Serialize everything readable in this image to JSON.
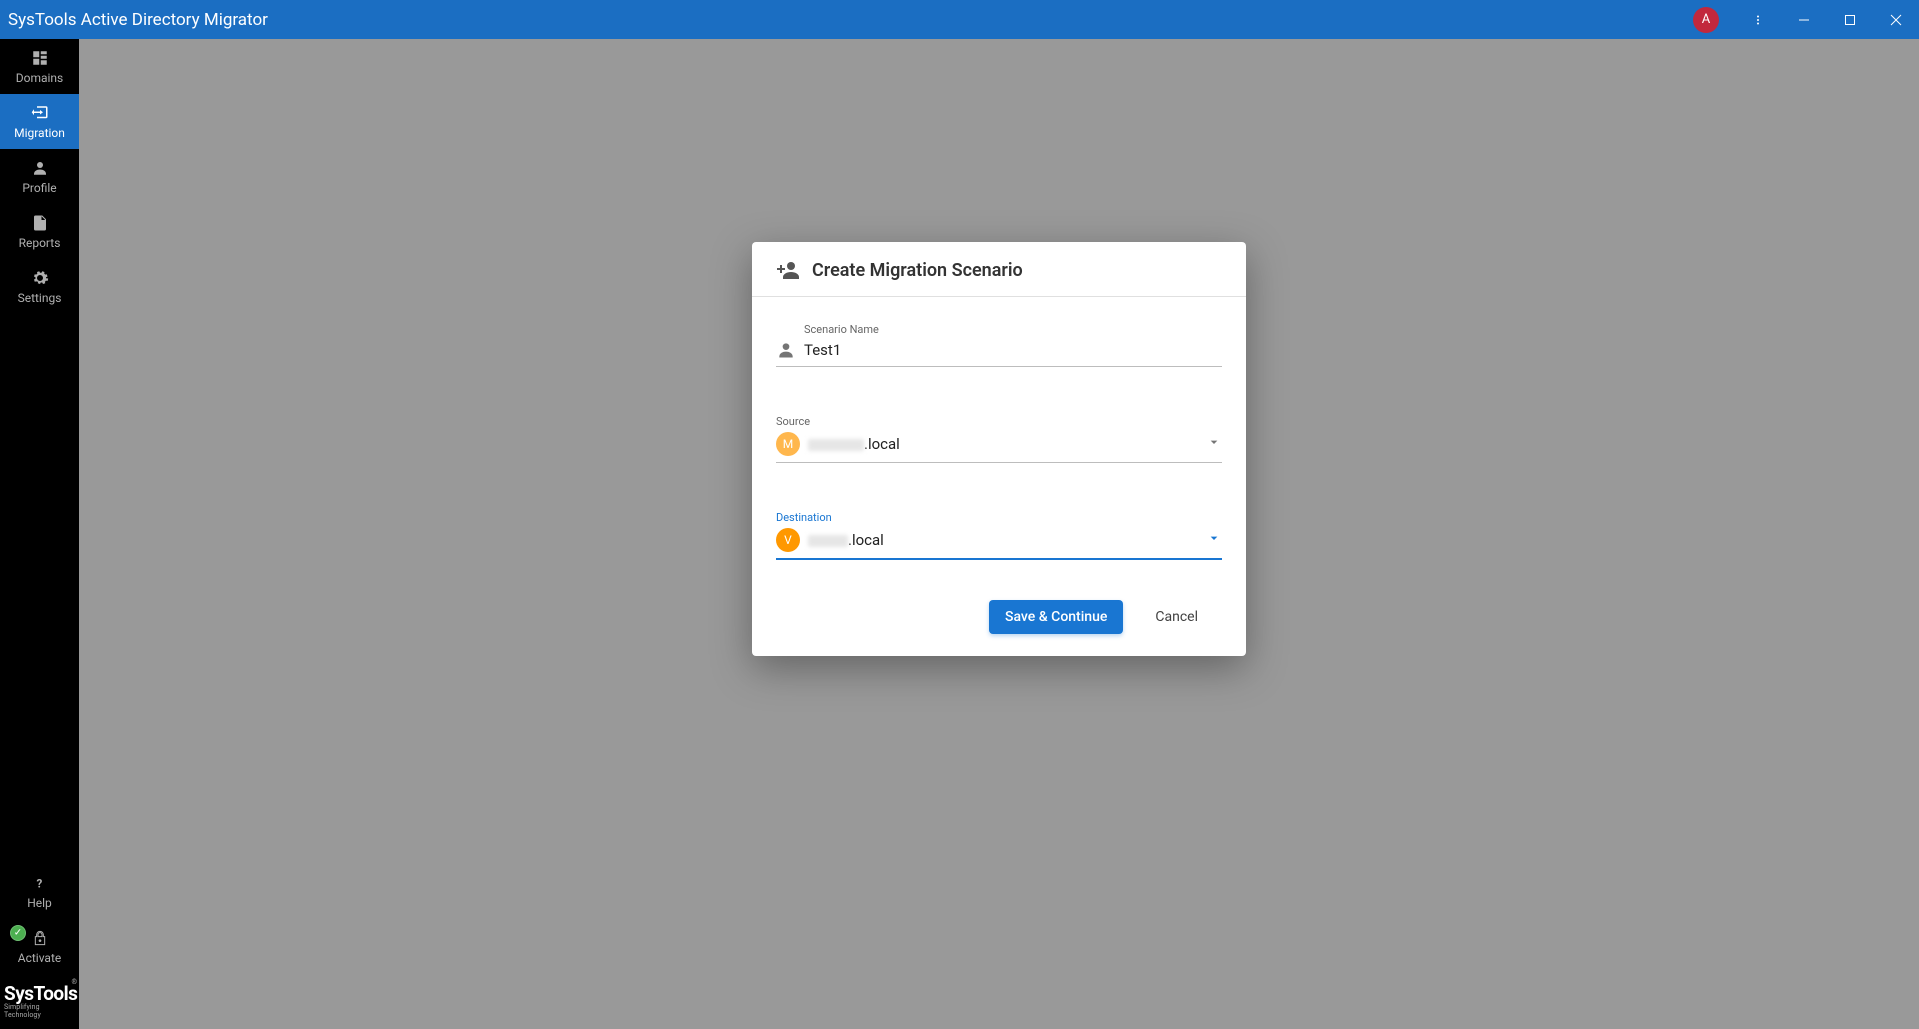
{
  "titlebar": {
    "title": "SysTools Active Directory Migrator",
    "avatar_letter": "A"
  },
  "sidebar": {
    "items": [
      {
        "label": "Domains"
      },
      {
        "label": "Migration"
      },
      {
        "label": "Profile"
      },
      {
        "label": "Reports"
      },
      {
        "label": "Settings"
      }
    ],
    "bottom": [
      {
        "label": "Help"
      },
      {
        "label": "Activate"
      }
    ],
    "brand": {
      "name": "SysTools",
      "tag": "Simplifying Technology",
      "reg": "®"
    }
  },
  "dialog": {
    "title": "Create Migration Scenario",
    "scenario": {
      "label": "Scenario Name",
      "value": "Test1"
    },
    "source": {
      "label": "Source",
      "avatar": "M",
      "suffix": ".local"
    },
    "destination": {
      "label": "Destination",
      "avatar": "V",
      "suffix": ".local"
    },
    "actions": {
      "save": "Save & Continue",
      "cancel": "Cancel"
    }
  }
}
